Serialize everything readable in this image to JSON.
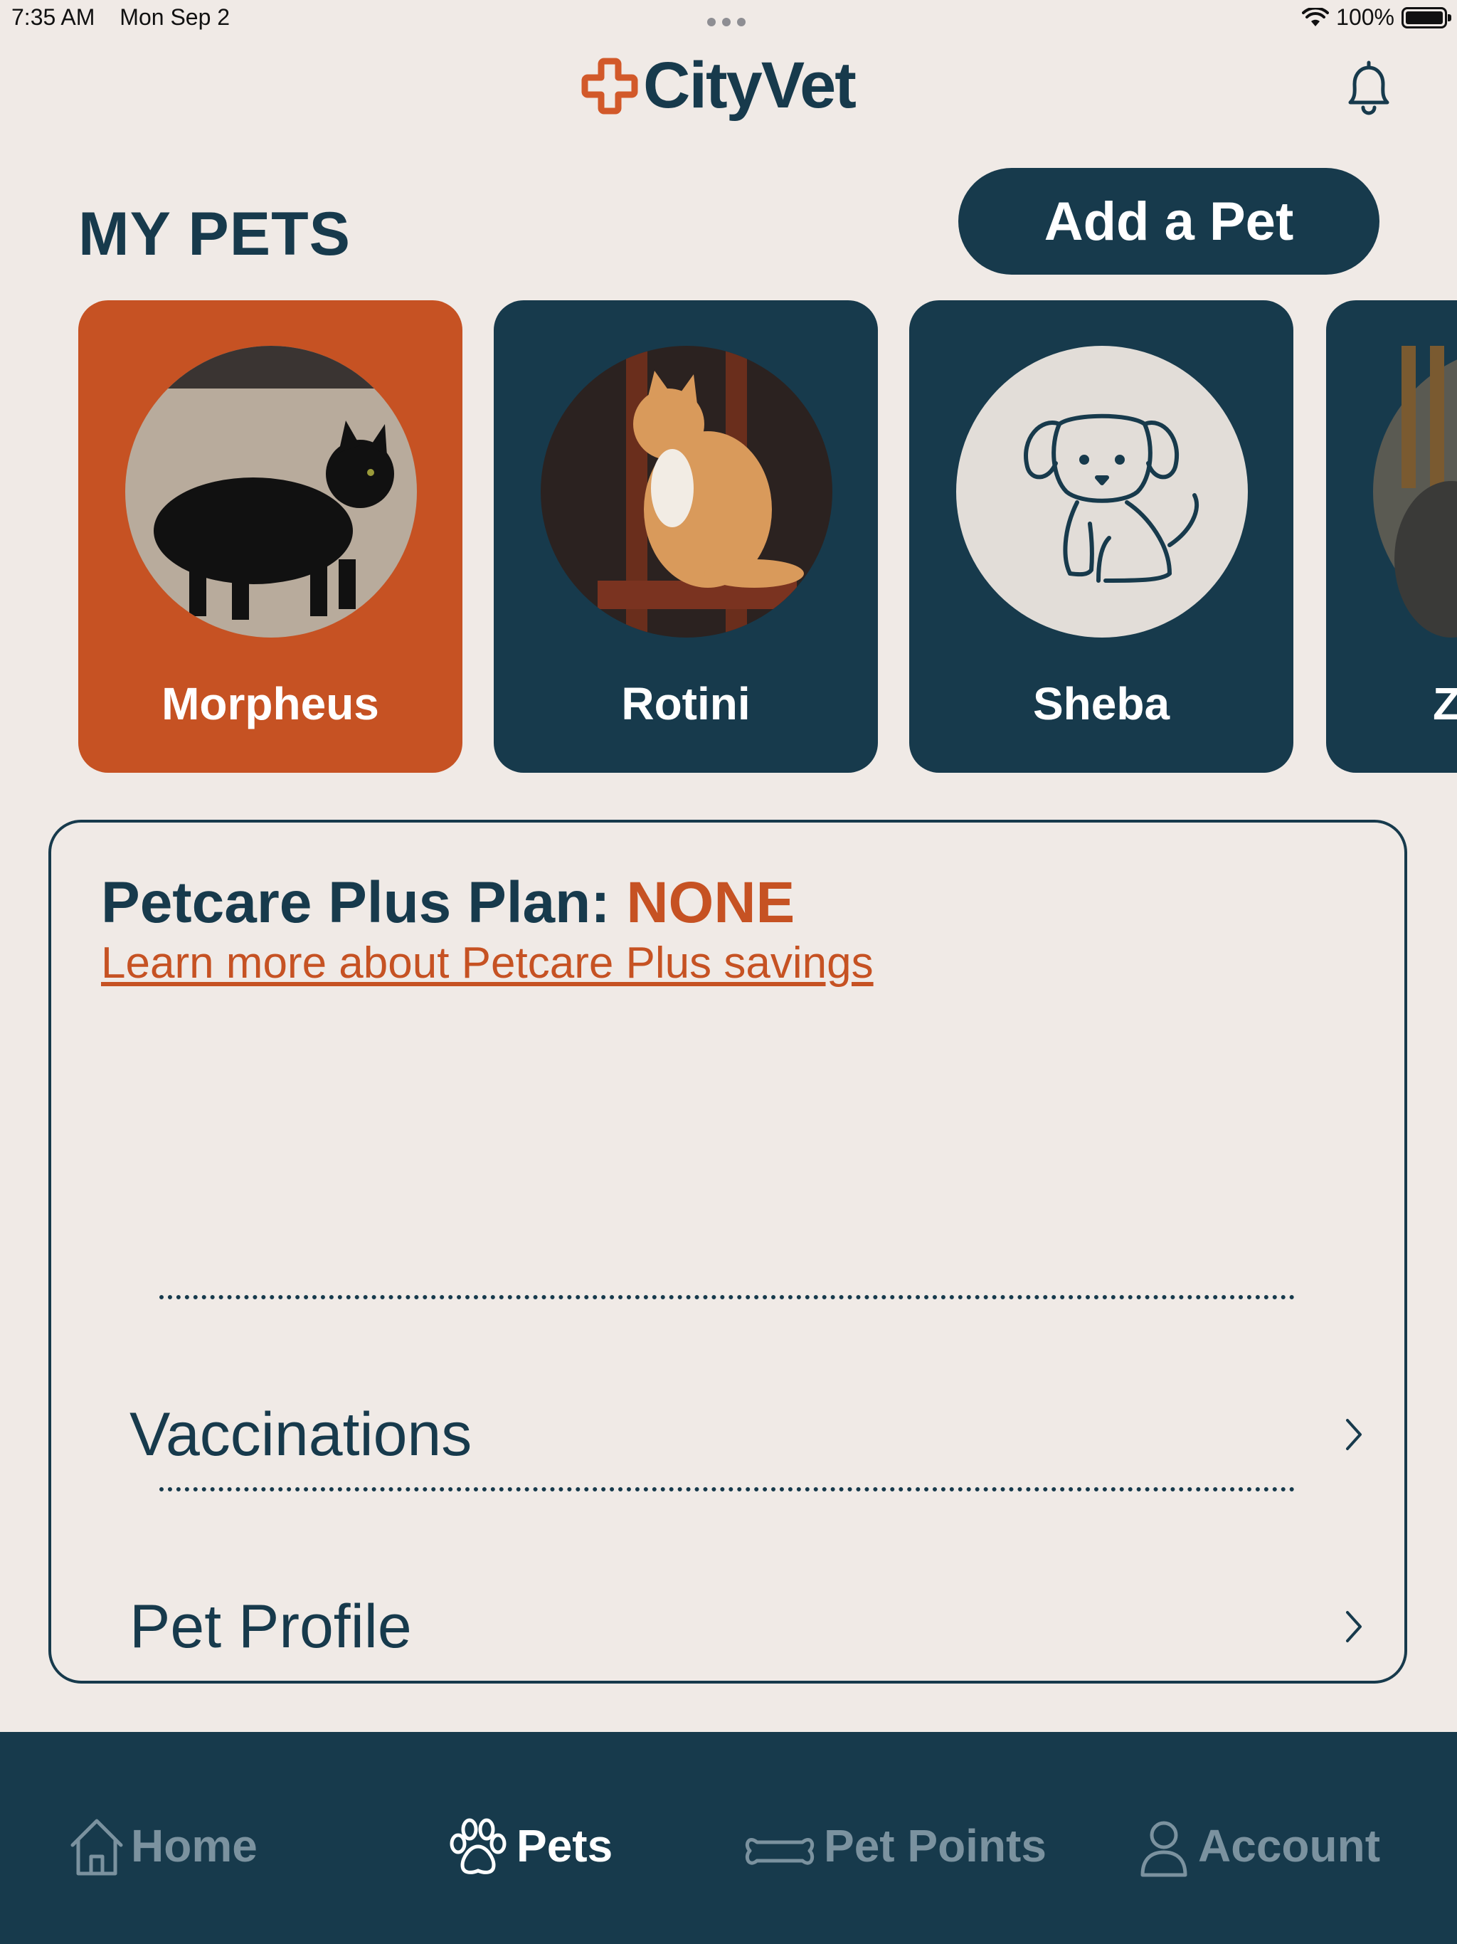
{
  "status_bar": {
    "time": "7:35 AM",
    "date": "Mon Sep 2",
    "battery": "100%"
  },
  "header": {
    "logo_text": "CityVet"
  },
  "my_pets": {
    "title": "MY PETS",
    "add_button": "Add a Pet",
    "pets": [
      {
        "name": "Morpheus",
        "selected": true,
        "photo": "black-cat"
      },
      {
        "name": "Rotini",
        "selected": false,
        "photo": "orange-cat"
      },
      {
        "name": "Sheba",
        "selected": false,
        "photo": "dog-placeholder-icon"
      },
      {
        "name": "Z",
        "selected": false,
        "photo": "gray-pet"
      }
    ]
  },
  "plan_card": {
    "plan_label": "Petcare Plus Plan: ",
    "plan_value": "NONE",
    "learn_more": "Learn more about Petcare Plus savings",
    "rows": [
      {
        "label": "Vaccinations"
      },
      {
        "label": "Pet Profile"
      }
    ]
  },
  "tab_bar": {
    "tabs": [
      {
        "label": "Home",
        "icon": "house-icon",
        "active": false
      },
      {
        "label": "Pets",
        "icon": "paw-icon",
        "active": true
      },
      {
        "label": "Pet Points",
        "icon": "bone-icon",
        "active": false
      },
      {
        "label": "Account",
        "icon": "person-icon",
        "active": false
      }
    ]
  },
  "colors": {
    "navy": "#173a4c",
    "orange": "#c65223",
    "background": "#f0eae6",
    "inactive_tab": "#7b929f"
  }
}
